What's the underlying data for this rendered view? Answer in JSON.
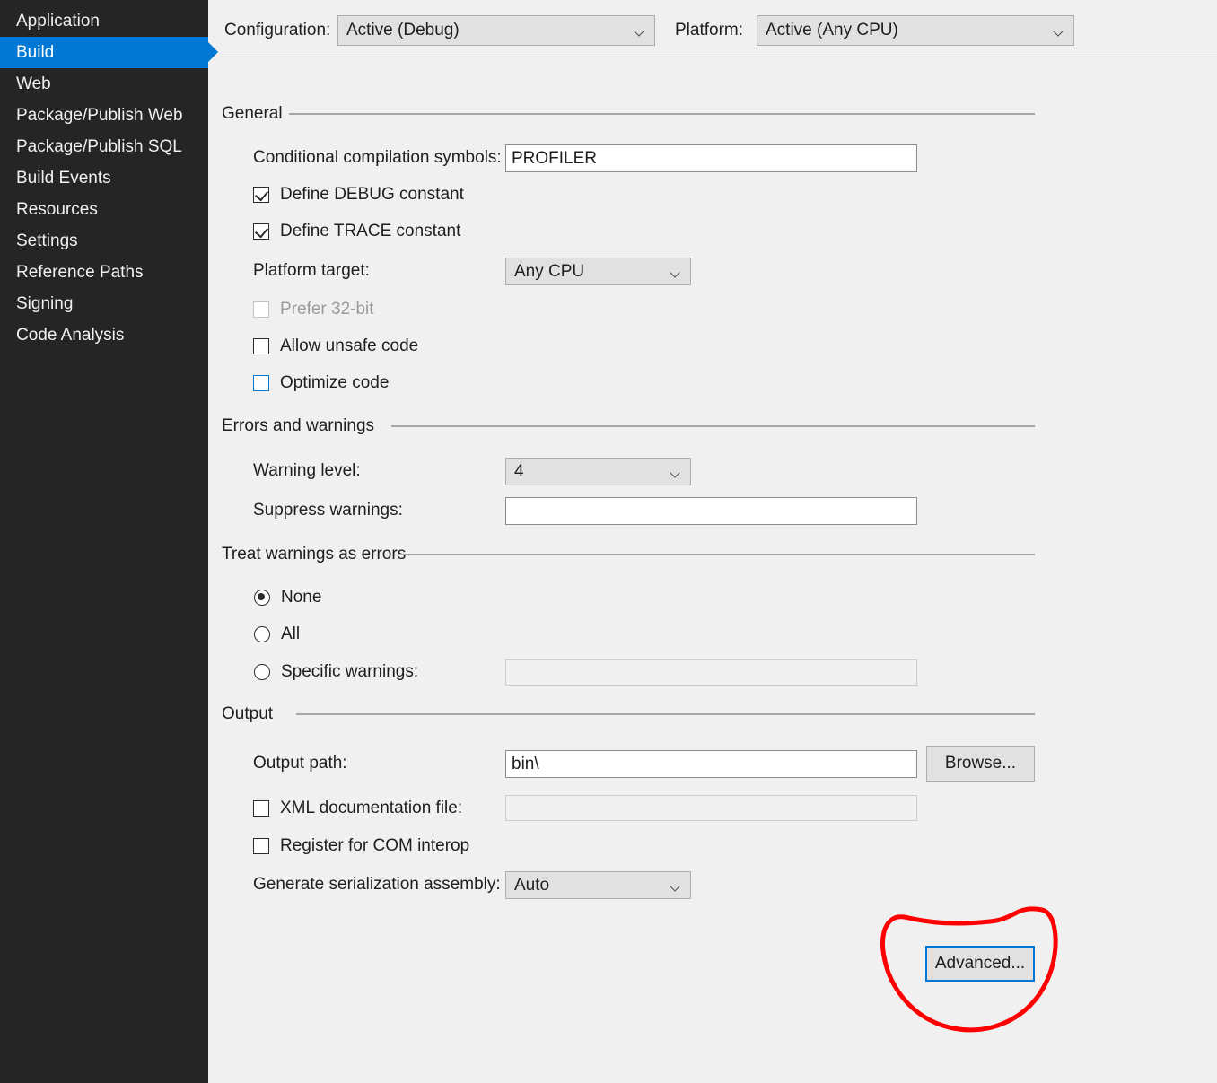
{
  "sidebar": {
    "items": [
      {
        "label": "Application",
        "selected": false
      },
      {
        "label": "Build",
        "selected": true
      },
      {
        "label": "Web",
        "selected": false
      },
      {
        "label": "Package/Publish Web",
        "selected": false
      },
      {
        "label": "Package/Publish SQL",
        "selected": false
      },
      {
        "label": "Build Events",
        "selected": false
      },
      {
        "label": "Resources",
        "selected": false
      },
      {
        "label": "Settings",
        "selected": false
      },
      {
        "label": "Reference Paths",
        "selected": false
      },
      {
        "label": "Signing",
        "selected": false
      },
      {
        "label": "Code Analysis",
        "selected": false
      }
    ]
  },
  "config_bar": {
    "configuration_label": "Configuration:",
    "configuration_value": "Active (Debug)",
    "platform_label": "Platform:",
    "platform_value": "Active (Any CPU)"
  },
  "general": {
    "header": "General",
    "conditional_symbols_label": "Conditional compilation symbols:",
    "conditional_symbols_value": "PROFILER",
    "define_debug_label": "Define DEBUG constant",
    "define_debug_checked": true,
    "define_trace_label": "Define TRACE constant",
    "define_trace_checked": true,
    "platform_target_label": "Platform target:",
    "platform_target_value": "Any CPU",
    "prefer_32bit_label": "Prefer 32-bit",
    "prefer_32bit_checked": false,
    "prefer_32bit_disabled": true,
    "allow_unsafe_label": "Allow unsafe code",
    "allow_unsafe_checked": false,
    "optimize_code_label": "Optimize code",
    "optimize_code_checked": false,
    "optimize_code_focused": true
  },
  "errors_warnings": {
    "header": "Errors and warnings",
    "warning_level_label": "Warning level:",
    "warning_level_value": "4",
    "suppress_warnings_label": "Suppress warnings:",
    "suppress_warnings_value": ""
  },
  "treat_warnings": {
    "header": "Treat warnings as errors",
    "none_label": "None",
    "none_selected": true,
    "all_label": "All",
    "all_selected": false,
    "specific_label": "Specific warnings:",
    "specific_selected": false,
    "specific_value": ""
  },
  "output": {
    "header": "Output",
    "output_path_label": "Output path:",
    "output_path_value": "bin\\",
    "browse_label": "Browse...",
    "xml_doc_label": "XML documentation file:",
    "xml_doc_checked": false,
    "xml_doc_value": "",
    "register_com_label": "Register for COM interop",
    "register_com_checked": false,
    "serialization_label": "Generate serialization assembly:",
    "serialization_value": "Auto"
  },
  "advanced": {
    "label": "Advanced...",
    "focused": true
  },
  "colors": {
    "sidebar_bg": "#252526",
    "accent_blue": "#0078d4",
    "panel_bg": "#f0f0f0",
    "control_bg": "#e1e1e1",
    "annotation_red": "#ff0000"
  }
}
